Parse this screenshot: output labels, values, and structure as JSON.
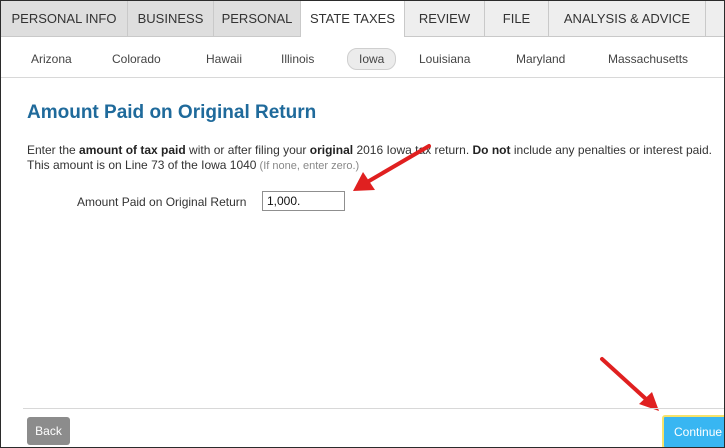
{
  "main_tabs": [
    {
      "label": "Personal Info",
      "state": "done"
    },
    {
      "label": "Business",
      "state": "done"
    },
    {
      "label": "Personal",
      "state": "done"
    },
    {
      "label": "State Taxes",
      "state": "active"
    },
    {
      "label": "Review",
      "state": "normal"
    },
    {
      "label": "File",
      "state": "normal"
    },
    {
      "label": "Analysis & Advice",
      "state": "normal"
    }
  ],
  "state_tabs": [
    {
      "label": "Arizona"
    },
    {
      "label": "Colorado"
    },
    {
      "label": "Hawaii"
    },
    {
      "label": "Illinois"
    },
    {
      "label": "Iowa",
      "selected": true
    },
    {
      "label": "Louisiana"
    },
    {
      "label": "Maryland"
    },
    {
      "label": "Massachusetts"
    }
  ],
  "page": {
    "title": "Amount Paid on Original Return",
    "intro": {
      "p1": "Enter the ",
      "b1": "amount of tax paid",
      "p2": " with or after filing your ",
      "b2": "original",
      "p3": " 2016 Iowa tax return. ",
      "b3": "Do not",
      "p4": " include any penalties or interest paid. This amount is on Line 73 of the Iowa 1040",
      "hint": " (If none, enter zero.)"
    },
    "field": {
      "label": "Amount Paid on Original Return",
      "value": "1,000."
    }
  },
  "footer": {
    "back_label": "Back",
    "continue_label": "Continue"
  },
  "colors": {
    "title": "#1f6a9b",
    "continue_button": "#38b6f2",
    "annotation_arrow": "#e02020"
  }
}
